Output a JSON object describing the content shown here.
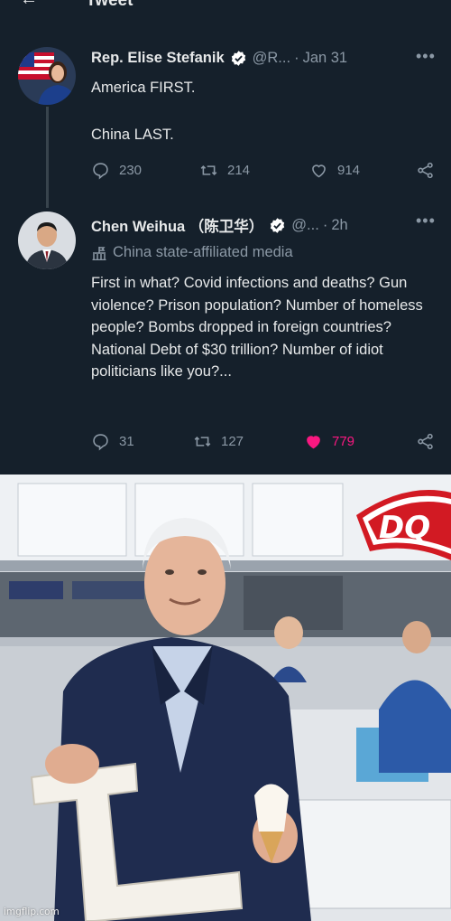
{
  "header": {
    "title": "Tweet",
    "back_icon": "arrow-left-icon"
  },
  "tweets": [
    {
      "author": "Rep. Elise Stefanik",
      "handle": "@R...",
      "separator": "·",
      "time": "Jan 31",
      "body_lines": [
        "America FIRST.",
        "China LAST."
      ],
      "stats": {
        "replies": "230",
        "retweets": "214",
        "likes": "914"
      }
    },
    {
      "author": "Chen Weihua （陈卫华）",
      "handle": "@...",
      "separator": "·",
      "time": "2h",
      "label": "China state-affiliated media",
      "body": "First in what? Covid infections and deaths? Gun violence? Prison population? Number of homeless people? Bombs dropped in foreign countries? National Debt of $30 trillion? Number of idiot politicians like you?...",
      "stats": {
        "replies": "31",
        "retweets": "127",
        "likes": "779"
      }
    }
  ],
  "colors": {
    "background": "#15202b",
    "muted": "#8b98a5",
    "like": "#f91880",
    "verified": "#ffffff"
  },
  "photo": {
    "sign_text": "DQ",
    "watermark": "imgflip.com"
  }
}
